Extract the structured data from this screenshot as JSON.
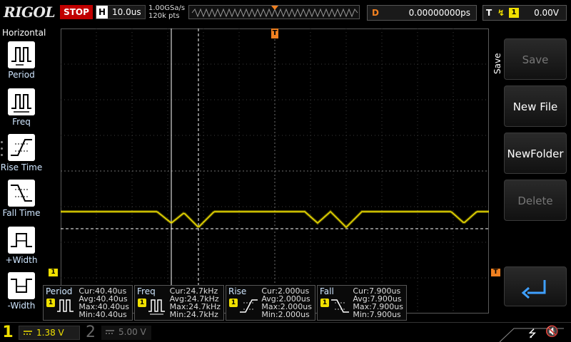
{
  "topbar": {
    "brand": "RIGOL",
    "run_state": "STOP",
    "horizontal_label": "H",
    "timebase": "10.0us",
    "sample_rate": "1.00GSa/s",
    "memory_depth": "120k pts",
    "delay_label": "D",
    "delay_value": "0.00000000ps",
    "trigger_label": "T",
    "trigger_channel": "1",
    "trigger_level": "0.00V"
  },
  "left_menu": {
    "title": "Horizontal",
    "items": [
      {
        "label": "Period",
        "icon": "period-icon"
      },
      {
        "label": "Freq",
        "icon": "frequency-icon"
      },
      {
        "label": "Rise Time",
        "icon": "rise-time-icon"
      },
      {
        "label": "Fall Time",
        "icon": "fall-time-icon"
      },
      {
        "label": "+Width",
        "icon": "positive-width-icon"
      },
      {
        "label": "-Width",
        "icon": "negative-width-icon"
      }
    ]
  },
  "right_menu": {
    "title": "Save",
    "buttons": [
      {
        "label": "Save",
        "enabled": false
      },
      {
        "label": "New File",
        "enabled": true
      },
      {
        "label": "NewFolder",
        "enabled": true
      },
      {
        "label": "Delete",
        "enabled": false
      }
    ],
    "return_icon": "return-arrow-icon"
  },
  "measurements": [
    {
      "name": "Period",
      "channel": "1",
      "cur": "Cur:40.40us",
      "avg": "Avg:40.40us",
      "max": "Max:40.40us",
      "min": "Min:40.40us"
    },
    {
      "name": "Freq",
      "channel": "1",
      "cur": "Cur:24.7kHz",
      "avg": "Avg:24.7kHz",
      "max": "Max:24.7kHz",
      "min": "Min:24.7kHz"
    },
    {
      "name": "Rise",
      "channel": "1",
      "cur": "Cur:2.000us",
      "avg": "Avg:2.000us",
      "max": "Max:2.000us",
      "min": "Min:2.000us"
    },
    {
      "name": "Fall",
      "channel": "1",
      "cur": "Cur:7.900us",
      "avg": "Avg:7.900us",
      "max": "Max:7.900us",
      "min": "Min:7.900us"
    }
  ],
  "channels": {
    "ch1_number": "1",
    "ch1_scale": "1.38 V",
    "ch2_number": "2",
    "ch2_scale": "5.00 V"
  },
  "markers": {
    "trigger_pos": "T",
    "ch1_offset": "1",
    "trigger_level": "T"
  },
  "colors": {
    "ch1": "#f0e000",
    "trigger": "#f08020",
    "stop": "#c00000",
    "menu_text": "#cfe6ff"
  }
}
